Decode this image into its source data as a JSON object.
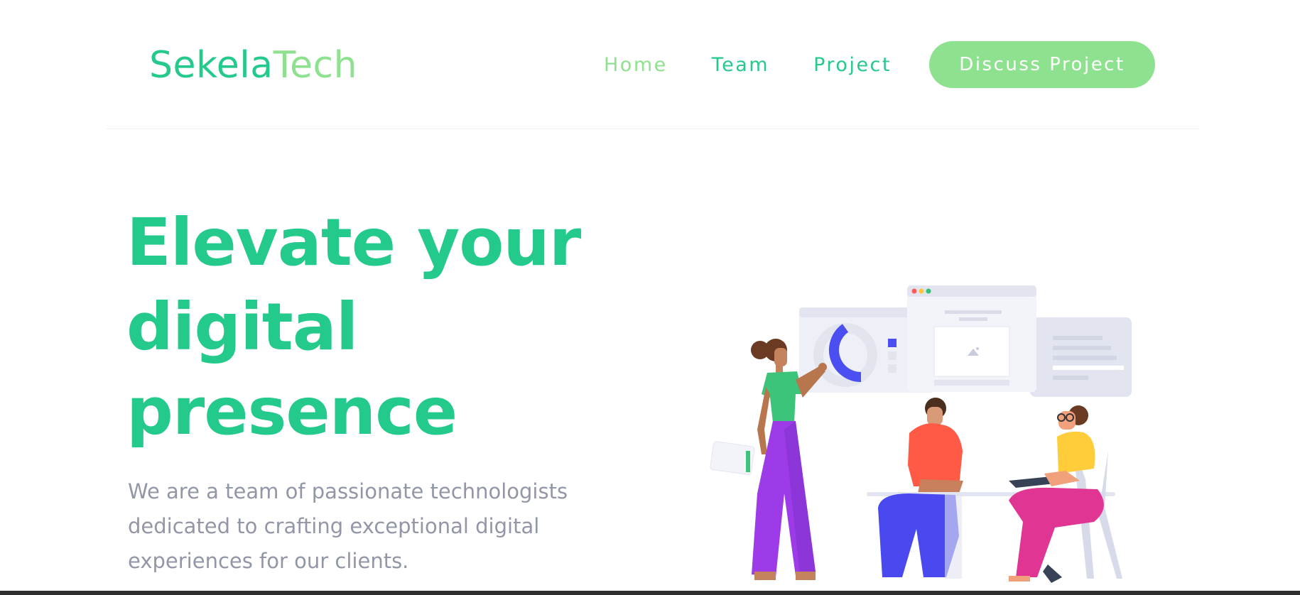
{
  "header": {
    "logo": {
      "part1": "Sekela",
      "part2": "Tech"
    },
    "nav": [
      {
        "label": "Home",
        "active": true
      },
      {
        "label": "Team",
        "active": false
      },
      {
        "label": "Project",
        "active": false
      }
    ],
    "cta_label": "Discuss Project"
  },
  "hero": {
    "title_line1": "Elevate your",
    "title_line2": "digital",
    "title_line3": "presence",
    "subtitle_line1": "We are a team of passionate technologists",
    "subtitle_line2": "dedicated to crafting exceptional digital",
    "subtitle_line3": "experiences for our clients."
  },
  "colors": {
    "primary": "#24c98c",
    "accent": "#8ee28f",
    "text_muted": "#9197a6"
  },
  "illustration": {
    "name": "team-collaboration-illustration"
  }
}
